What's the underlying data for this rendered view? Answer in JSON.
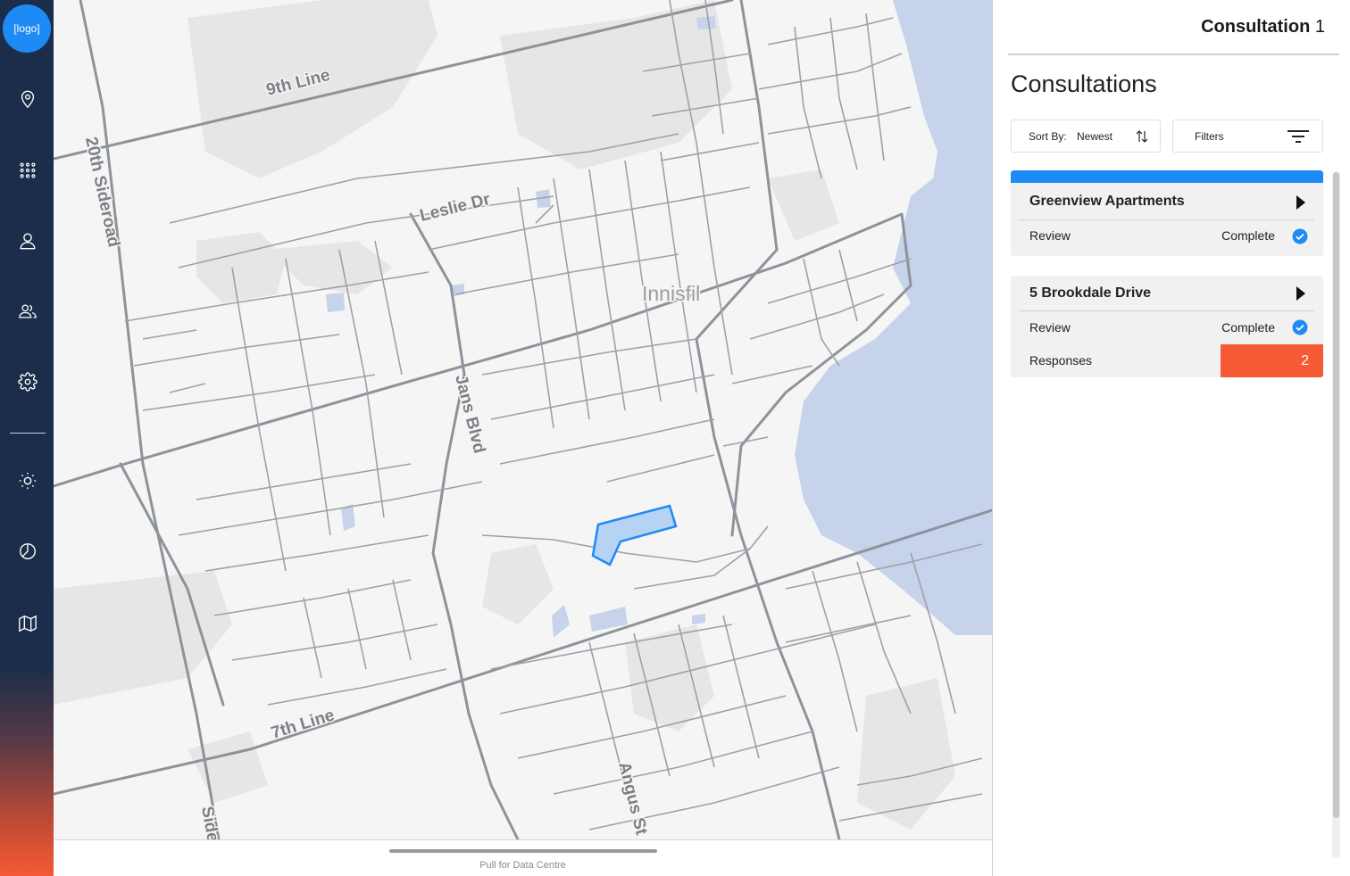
{
  "app": {
    "logo_text": "[logo]"
  },
  "sidebar": {
    "items": [
      {
        "icon": "map-pin-icon"
      },
      {
        "icon": "apps-grid-icon"
      },
      {
        "icon": "user-icon"
      },
      {
        "icon": "users-icon"
      },
      {
        "icon": "gear-icon"
      },
      {
        "icon": "sun-icon"
      },
      {
        "icon": "pie-chart-icon"
      },
      {
        "icon": "map-icon"
      }
    ]
  },
  "map": {
    "labels": {
      "road_9th": "9th Line",
      "road_20th": "20th Sideroad",
      "road_leslie": "Leslie Dr",
      "road_jans": "Jans Blvd",
      "road_7th": "7th Line",
      "road_angus": "Angus St",
      "road_side": "Side",
      "town": "Innisfil"
    },
    "colors": {
      "water": "#c6d3ea",
      "land": "#f5f5f5",
      "parks": "#e6e6e6",
      "roads": "#8e939b",
      "selection": "#1e8af5"
    }
  },
  "drawer": {
    "label": "Pull for Data Centre"
  },
  "panel": {
    "header_title": "Consultation",
    "header_count": "1",
    "heading": "Consultations",
    "sort": {
      "label": "Sort By:",
      "value": "Newest"
    },
    "filters": {
      "label": "Filters"
    },
    "cards": [
      {
        "title": "Greenview Apartments",
        "review_label": "Review",
        "review_status": "Complete"
      },
      {
        "title": "5 Brookdale Drive",
        "review_label": "Review",
        "review_status": "Complete",
        "responses_label": "Responses",
        "responses_count": "2"
      }
    ]
  },
  "colors": {
    "sidebar": "#1b2d4a",
    "accent": "#1e8af5",
    "alert": "#f65a35"
  }
}
